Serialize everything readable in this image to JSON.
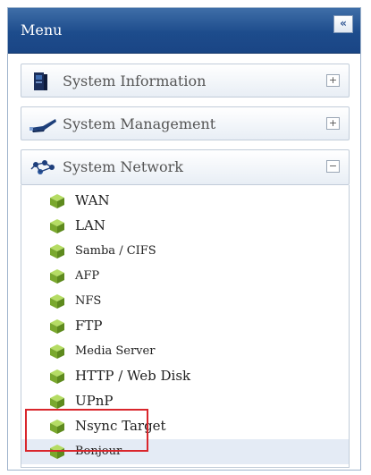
{
  "menu": {
    "title": "Menu",
    "collapse_glyph": "«"
  },
  "sections": [
    {
      "label": "System Information",
      "toggle": "+",
      "icon": "system-info-icon"
    },
    {
      "label": "System Management",
      "toggle": "+",
      "icon": "system-management-icon"
    },
    {
      "label": "System Network",
      "toggle": "−",
      "icon": "system-network-icon"
    }
  ],
  "network_items": [
    {
      "label": "WAN",
      "icon": "cube-icon"
    },
    {
      "label": "LAN",
      "icon": "cube-icon"
    },
    {
      "label": "Samba / CIFS",
      "icon": "cube-icon"
    },
    {
      "label": "AFP",
      "icon": "cube-icon"
    },
    {
      "label": "NFS",
      "icon": "cube-icon"
    },
    {
      "label": "FTP",
      "icon": "cube-icon"
    },
    {
      "label": "Media Server",
      "icon": "cube-icon"
    },
    {
      "label": "HTTP / Web Disk",
      "icon": "cube-icon"
    },
    {
      "label": "UPnP",
      "icon": "cube-icon"
    },
    {
      "label": "Nsync Target",
      "icon": "cube-icon"
    },
    {
      "label": "Bonjour",
      "icon": "cube-icon",
      "selected": true
    }
  ],
  "colors": {
    "header": "#1d4c8c",
    "highlight": "#d9262c",
    "cube": "#8fbf3a"
  }
}
